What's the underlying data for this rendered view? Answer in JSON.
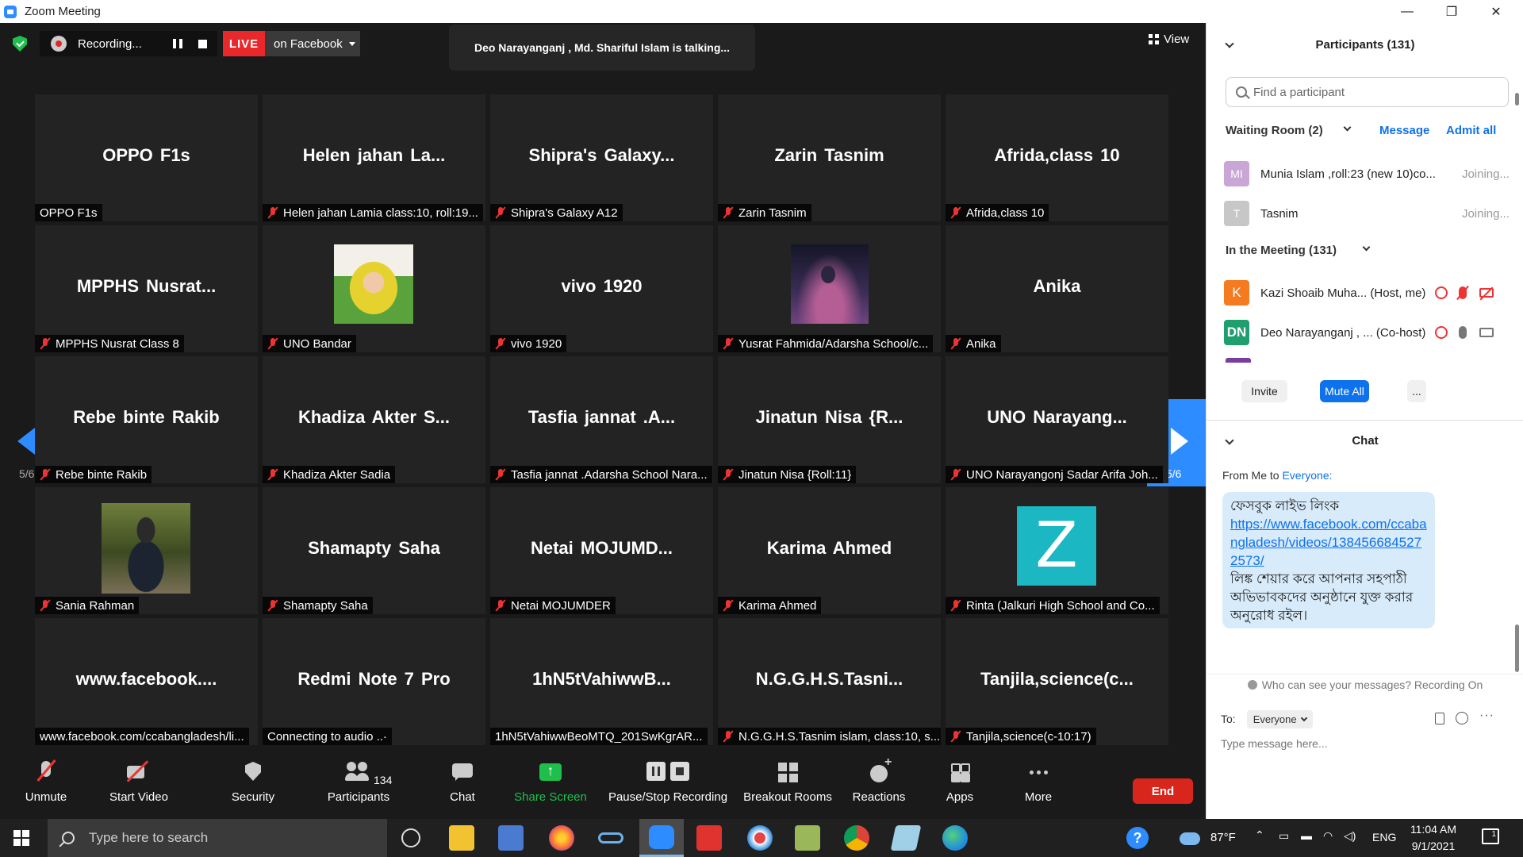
{
  "window": {
    "title": "Zoom Meeting",
    "controls": [
      "—",
      "❐",
      "✕"
    ]
  },
  "meeting": {
    "recording_label": "Recording...",
    "live_label": "LIVE",
    "live_target": "on Facebook",
    "talking": "Deo Narayanganj , Md. Shariful Islam is talking...",
    "view_label": "View",
    "page_left": "5/6",
    "page_right": "5/6"
  },
  "tiles": [
    {
      "big": "OPPO F1s",
      "name": "OPPO F1s",
      "muted": false
    },
    {
      "big": "Helen jahan La...",
      "name": "Helen jahan Lamia class:10, roll:19...",
      "muted": true
    },
    {
      "big": "Shipra's Galaxy...",
      "name": "Shipra's Galaxy A12",
      "muted": true
    },
    {
      "big": "Zarin Tasnim",
      "name": "Zarin Tasnim",
      "muted": true
    },
    {
      "big": "Afrida,class 10",
      "name": "Afrida,class 10",
      "muted": true
    },
    {
      "big": "MPPHS Nusrat...",
      "name": "MPPHS Nusrat Class 8",
      "muted": true
    },
    {
      "big": "",
      "name": "UNO Bandar",
      "muted": true,
      "photo": "uno"
    },
    {
      "big": "vivo 1920",
      "name": "vivo 1920",
      "muted": true
    },
    {
      "big": "",
      "name": "Yusrat Fahmida/Adarsha School/c...",
      "muted": true,
      "photo": "yusrat"
    },
    {
      "big": "Anika",
      "name": "Anika",
      "muted": true
    },
    {
      "big": "Rebe binte Rakib",
      "name": "Rebe binte Rakib",
      "muted": true
    },
    {
      "big": "Khadiza Akter S...",
      "name": "Khadiza Akter Sadia",
      "muted": true
    },
    {
      "big": "Tasfia jannat .A...",
      "name": "Tasfia jannat .Adarsha School Nara...",
      "muted": true
    },
    {
      "big": "Jinatun Nisa {R...",
      "name": "Jinatun Nisa {Roll:11}",
      "muted": true
    },
    {
      "big": "UNO Narayang...",
      "name": "UNO Narayangonj Sadar Arifa Joh...",
      "muted": true
    },
    {
      "big": "",
      "name": "Sania Rahman",
      "muted": true,
      "photo": "sania"
    },
    {
      "big": "Shamapty Saha",
      "name": "Shamapty Saha",
      "muted": true
    },
    {
      "big": "Netai MOJUMD...",
      "name": "Netai MOJUMDER",
      "muted": true
    },
    {
      "big": "Karima Ahmed",
      "name": "Karima Ahmed",
      "muted": true
    },
    {
      "big": "",
      "name": "Rinta (Jalkuri High School and Co...",
      "muted": true,
      "photo": "rinta",
      "photo_letter": "Z"
    },
    {
      "big": "www.facebook....",
      "name": "www.facebook.com/ccabangladesh/li...",
      "muted": false
    },
    {
      "big": "Redmi Note 7 Pro",
      "name": "Connecting to audio ..·",
      "muted": false
    },
    {
      "big": "1hN5tVahiwwB...",
      "name": "1hN5tVahiwwBeoMTQ_201SwKgrAR...",
      "muted": false
    },
    {
      "big": "N.G.G.H.S.Tasni...",
      "name": "N.G.G.H.S.Tasnim islam, class:10, s...",
      "muted": true
    },
    {
      "big": "Tanjila,science(c...",
      "name": "Tanjila,science(c-10:17)",
      "muted": true
    }
  ],
  "toolbar": {
    "unmute": "Unmute",
    "start_video": "Start Video",
    "security": "Security",
    "participants": "Participants",
    "participants_count": "134",
    "chat": "Chat",
    "share_screen": "Share Screen",
    "pause_stop": "Pause/Stop Recording",
    "breakout": "Breakout Rooms",
    "reactions": "Reactions",
    "apps": "Apps",
    "more": "More",
    "end": "End"
  },
  "panel": {
    "participants_title": "Participants (131)",
    "find_placeholder": "Find a participant",
    "waiting_room": "Waiting Room (2)",
    "message": "Message",
    "admit_all": "Admit all",
    "waiting": [
      {
        "initials": "MI",
        "name": "Munia Islam ,roll:23 (new 10)co...",
        "status": "Joining...",
        "color": "#c9a6d6"
      },
      {
        "initials": "T",
        "name": "Tasnim",
        "status": "Joining...",
        "color": "#c7c7c7"
      }
    ],
    "in_meeting": "In the Meeting (131)",
    "members": [
      {
        "initials": "K",
        "name": "Kazi Shoaib Muha... (Host, me)",
        "color": "#f47b20"
      },
      {
        "initials": "DN",
        "name": "Deo Narayanganj , ... (Co-host)",
        "color": "#1f9e6e"
      }
    ],
    "invite": "Invite",
    "mute_all": "Mute All",
    "more": "...",
    "chat_title": "Chat",
    "chat_from": "From Me to",
    "chat_to": "Everyone:",
    "chat_line1": "ফেসবুক লাইভ লিংক",
    "chat_link": "https://www.facebook.com/ccabangladesh/videos/1384566845272573/",
    "chat_line2": "লিঙ্ক শেয়ার করে আপনার সহপাঠী অভিভাবকদের অনুষ্ঠানে যুক্ত করার অনুরোধ রইল।",
    "who_can_see": "Who can see your messages? Recording On",
    "to_label": "To:",
    "to_value": "Everyone",
    "type_placeholder": "Type message here..."
  },
  "taskbar": {
    "search_placeholder": "Type here to search",
    "temperature": "87°F",
    "language": "ENG",
    "time": "11:04 AM",
    "date": "9/1/2021",
    "notifications": "1"
  }
}
